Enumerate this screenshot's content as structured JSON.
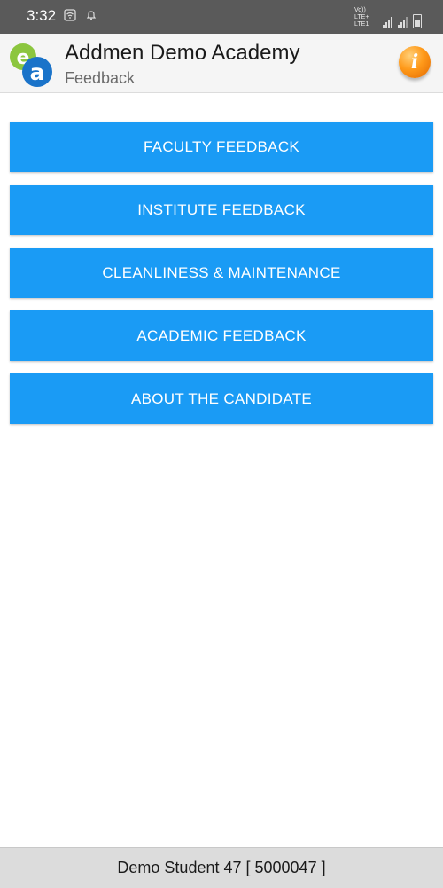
{
  "status_bar": {
    "time": "3:32",
    "network": "Vo)) LTE+ LTE1"
  },
  "header": {
    "title": "Addmen Demo Academy",
    "subtitle": "Feedback",
    "info_glyph": "i"
  },
  "menu": {
    "items": [
      {
        "label": "FACULTY FEEDBACK"
      },
      {
        "label": "INSTITUTE FEEDBACK"
      },
      {
        "label": "CLEANLINESS & MAINTENANCE"
      },
      {
        "label": "ACADEMIC FEEDBACK"
      },
      {
        "label": "ABOUT THE CANDIDATE"
      }
    ]
  },
  "footer": {
    "user_text": "Demo Student 47 [ 5000047 ]"
  },
  "colors": {
    "status_bar": "#5a5a5a",
    "app_bar": "#f5f5f5",
    "button": "#1a9bf5",
    "footer": "#dcdcdc"
  }
}
